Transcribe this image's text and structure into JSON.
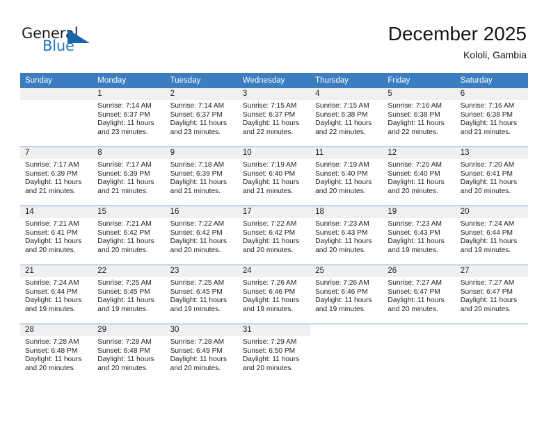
{
  "brand": {
    "name_top": "General",
    "name_bottom": "Blue",
    "triangle_color": "#1566ac",
    "blue_text_color": "#2275bb"
  },
  "header": {
    "title": "December 2025",
    "location": "Kololi, Gambia",
    "header_bg": "#3a7dc0"
  },
  "weekdays": [
    "Sunday",
    "Monday",
    "Tuesday",
    "Wednesday",
    "Thursday",
    "Friday",
    "Saturday"
  ],
  "weeks": [
    [
      {
        "day": "",
        "sunrise": "",
        "sunset": "",
        "daylight1": "",
        "daylight2": ""
      },
      {
        "day": "1",
        "sunrise": "Sunrise: 7:14 AM",
        "sunset": "Sunset: 6:37 PM",
        "daylight1": "Daylight: 11 hours",
        "daylight2": "and 23 minutes."
      },
      {
        "day": "2",
        "sunrise": "Sunrise: 7:14 AM",
        "sunset": "Sunset: 6:37 PM",
        "daylight1": "Daylight: 11 hours",
        "daylight2": "and 23 minutes."
      },
      {
        "day": "3",
        "sunrise": "Sunrise: 7:15 AM",
        "sunset": "Sunset: 6:37 PM",
        "daylight1": "Daylight: 11 hours",
        "daylight2": "and 22 minutes."
      },
      {
        "day": "4",
        "sunrise": "Sunrise: 7:15 AM",
        "sunset": "Sunset: 6:38 PM",
        "daylight1": "Daylight: 11 hours",
        "daylight2": "and 22 minutes."
      },
      {
        "day": "5",
        "sunrise": "Sunrise: 7:16 AM",
        "sunset": "Sunset: 6:38 PM",
        "daylight1": "Daylight: 11 hours",
        "daylight2": "and 22 minutes."
      },
      {
        "day": "6",
        "sunrise": "Sunrise: 7:16 AM",
        "sunset": "Sunset: 6:38 PM",
        "daylight1": "Daylight: 11 hours",
        "daylight2": "and 21 minutes."
      }
    ],
    [
      {
        "day": "7",
        "sunrise": "Sunrise: 7:17 AM",
        "sunset": "Sunset: 6:39 PM",
        "daylight1": "Daylight: 11 hours",
        "daylight2": "and 21 minutes."
      },
      {
        "day": "8",
        "sunrise": "Sunrise: 7:17 AM",
        "sunset": "Sunset: 6:39 PM",
        "daylight1": "Daylight: 11 hours",
        "daylight2": "and 21 minutes."
      },
      {
        "day": "9",
        "sunrise": "Sunrise: 7:18 AM",
        "sunset": "Sunset: 6:39 PM",
        "daylight1": "Daylight: 11 hours",
        "daylight2": "and 21 minutes."
      },
      {
        "day": "10",
        "sunrise": "Sunrise: 7:19 AM",
        "sunset": "Sunset: 6:40 PM",
        "daylight1": "Daylight: 11 hours",
        "daylight2": "and 21 minutes."
      },
      {
        "day": "11",
        "sunrise": "Sunrise: 7:19 AM",
        "sunset": "Sunset: 6:40 PM",
        "daylight1": "Daylight: 11 hours",
        "daylight2": "and 20 minutes."
      },
      {
        "day": "12",
        "sunrise": "Sunrise: 7:20 AM",
        "sunset": "Sunset: 6:40 PM",
        "daylight1": "Daylight: 11 hours",
        "daylight2": "and 20 minutes."
      },
      {
        "day": "13",
        "sunrise": "Sunrise: 7:20 AM",
        "sunset": "Sunset: 6:41 PM",
        "daylight1": "Daylight: 11 hours",
        "daylight2": "and 20 minutes."
      }
    ],
    [
      {
        "day": "14",
        "sunrise": "Sunrise: 7:21 AM",
        "sunset": "Sunset: 6:41 PM",
        "daylight1": "Daylight: 11 hours",
        "daylight2": "and 20 minutes."
      },
      {
        "day": "15",
        "sunrise": "Sunrise: 7:21 AM",
        "sunset": "Sunset: 6:42 PM",
        "daylight1": "Daylight: 11 hours",
        "daylight2": "and 20 minutes."
      },
      {
        "day": "16",
        "sunrise": "Sunrise: 7:22 AM",
        "sunset": "Sunset: 6:42 PM",
        "daylight1": "Daylight: 11 hours",
        "daylight2": "and 20 minutes."
      },
      {
        "day": "17",
        "sunrise": "Sunrise: 7:22 AM",
        "sunset": "Sunset: 6:42 PM",
        "daylight1": "Daylight: 11 hours",
        "daylight2": "and 20 minutes."
      },
      {
        "day": "18",
        "sunrise": "Sunrise: 7:23 AM",
        "sunset": "Sunset: 6:43 PM",
        "daylight1": "Daylight: 11 hours",
        "daylight2": "and 20 minutes."
      },
      {
        "day": "19",
        "sunrise": "Sunrise: 7:23 AM",
        "sunset": "Sunset: 6:43 PM",
        "daylight1": "Daylight: 11 hours",
        "daylight2": "and 19 minutes."
      },
      {
        "day": "20",
        "sunrise": "Sunrise: 7:24 AM",
        "sunset": "Sunset: 6:44 PM",
        "daylight1": "Daylight: 11 hours",
        "daylight2": "and 19 minutes."
      }
    ],
    [
      {
        "day": "21",
        "sunrise": "Sunrise: 7:24 AM",
        "sunset": "Sunset: 6:44 PM",
        "daylight1": "Daylight: 11 hours",
        "daylight2": "and 19 minutes."
      },
      {
        "day": "22",
        "sunrise": "Sunrise: 7:25 AM",
        "sunset": "Sunset: 6:45 PM",
        "daylight1": "Daylight: 11 hours",
        "daylight2": "and 19 minutes."
      },
      {
        "day": "23",
        "sunrise": "Sunrise: 7:25 AM",
        "sunset": "Sunset: 6:45 PM",
        "daylight1": "Daylight: 11 hours",
        "daylight2": "and 19 minutes."
      },
      {
        "day": "24",
        "sunrise": "Sunrise: 7:26 AM",
        "sunset": "Sunset: 6:46 PM",
        "daylight1": "Daylight: 11 hours",
        "daylight2": "and 19 minutes."
      },
      {
        "day": "25",
        "sunrise": "Sunrise: 7:26 AM",
        "sunset": "Sunset: 6:46 PM",
        "daylight1": "Daylight: 11 hours",
        "daylight2": "and 19 minutes."
      },
      {
        "day": "26",
        "sunrise": "Sunrise: 7:27 AM",
        "sunset": "Sunset: 6:47 PM",
        "daylight1": "Daylight: 11 hours",
        "daylight2": "and 20 minutes."
      },
      {
        "day": "27",
        "sunrise": "Sunrise: 7:27 AM",
        "sunset": "Sunset: 6:47 PM",
        "daylight1": "Daylight: 11 hours",
        "daylight2": "and 20 minutes."
      }
    ],
    [
      {
        "day": "28",
        "sunrise": "Sunrise: 7:28 AM",
        "sunset": "Sunset: 6:48 PM",
        "daylight1": "Daylight: 11 hours",
        "daylight2": "and 20 minutes."
      },
      {
        "day": "29",
        "sunrise": "Sunrise: 7:28 AM",
        "sunset": "Sunset: 6:48 PM",
        "daylight1": "Daylight: 11 hours",
        "daylight2": "and 20 minutes."
      },
      {
        "day": "30",
        "sunrise": "Sunrise: 7:28 AM",
        "sunset": "Sunset: 6:49 PM",
        "daylight1": "Daylight: 11 hours",
        "daylight2": "and 20 minutes."
      },
      {
        "day": "31",
        "sunrise": "Sunrise: 7:29 AM",
        "sunset": "Sunset: 6:50 PM",
        "daylight1": "Daylight: 11 hours",
        "daylight2": "and 20 minutes."
      },
      {
        "day": "",
        "sunrise": "",
        "sunset": "",
        "daylight1": "",
        "daylight2": ""
      },
      {
        "day": "",
        "sunrise": "",
        "sunset": "",
        "daylight1": "",
        "daylight2": ""
      },
      {
        "day": "",
        "sunrise": "",
        "sunset": "",
        "daylight1": "",
        "daylight2": ""
      }
    ]
  ]
}
